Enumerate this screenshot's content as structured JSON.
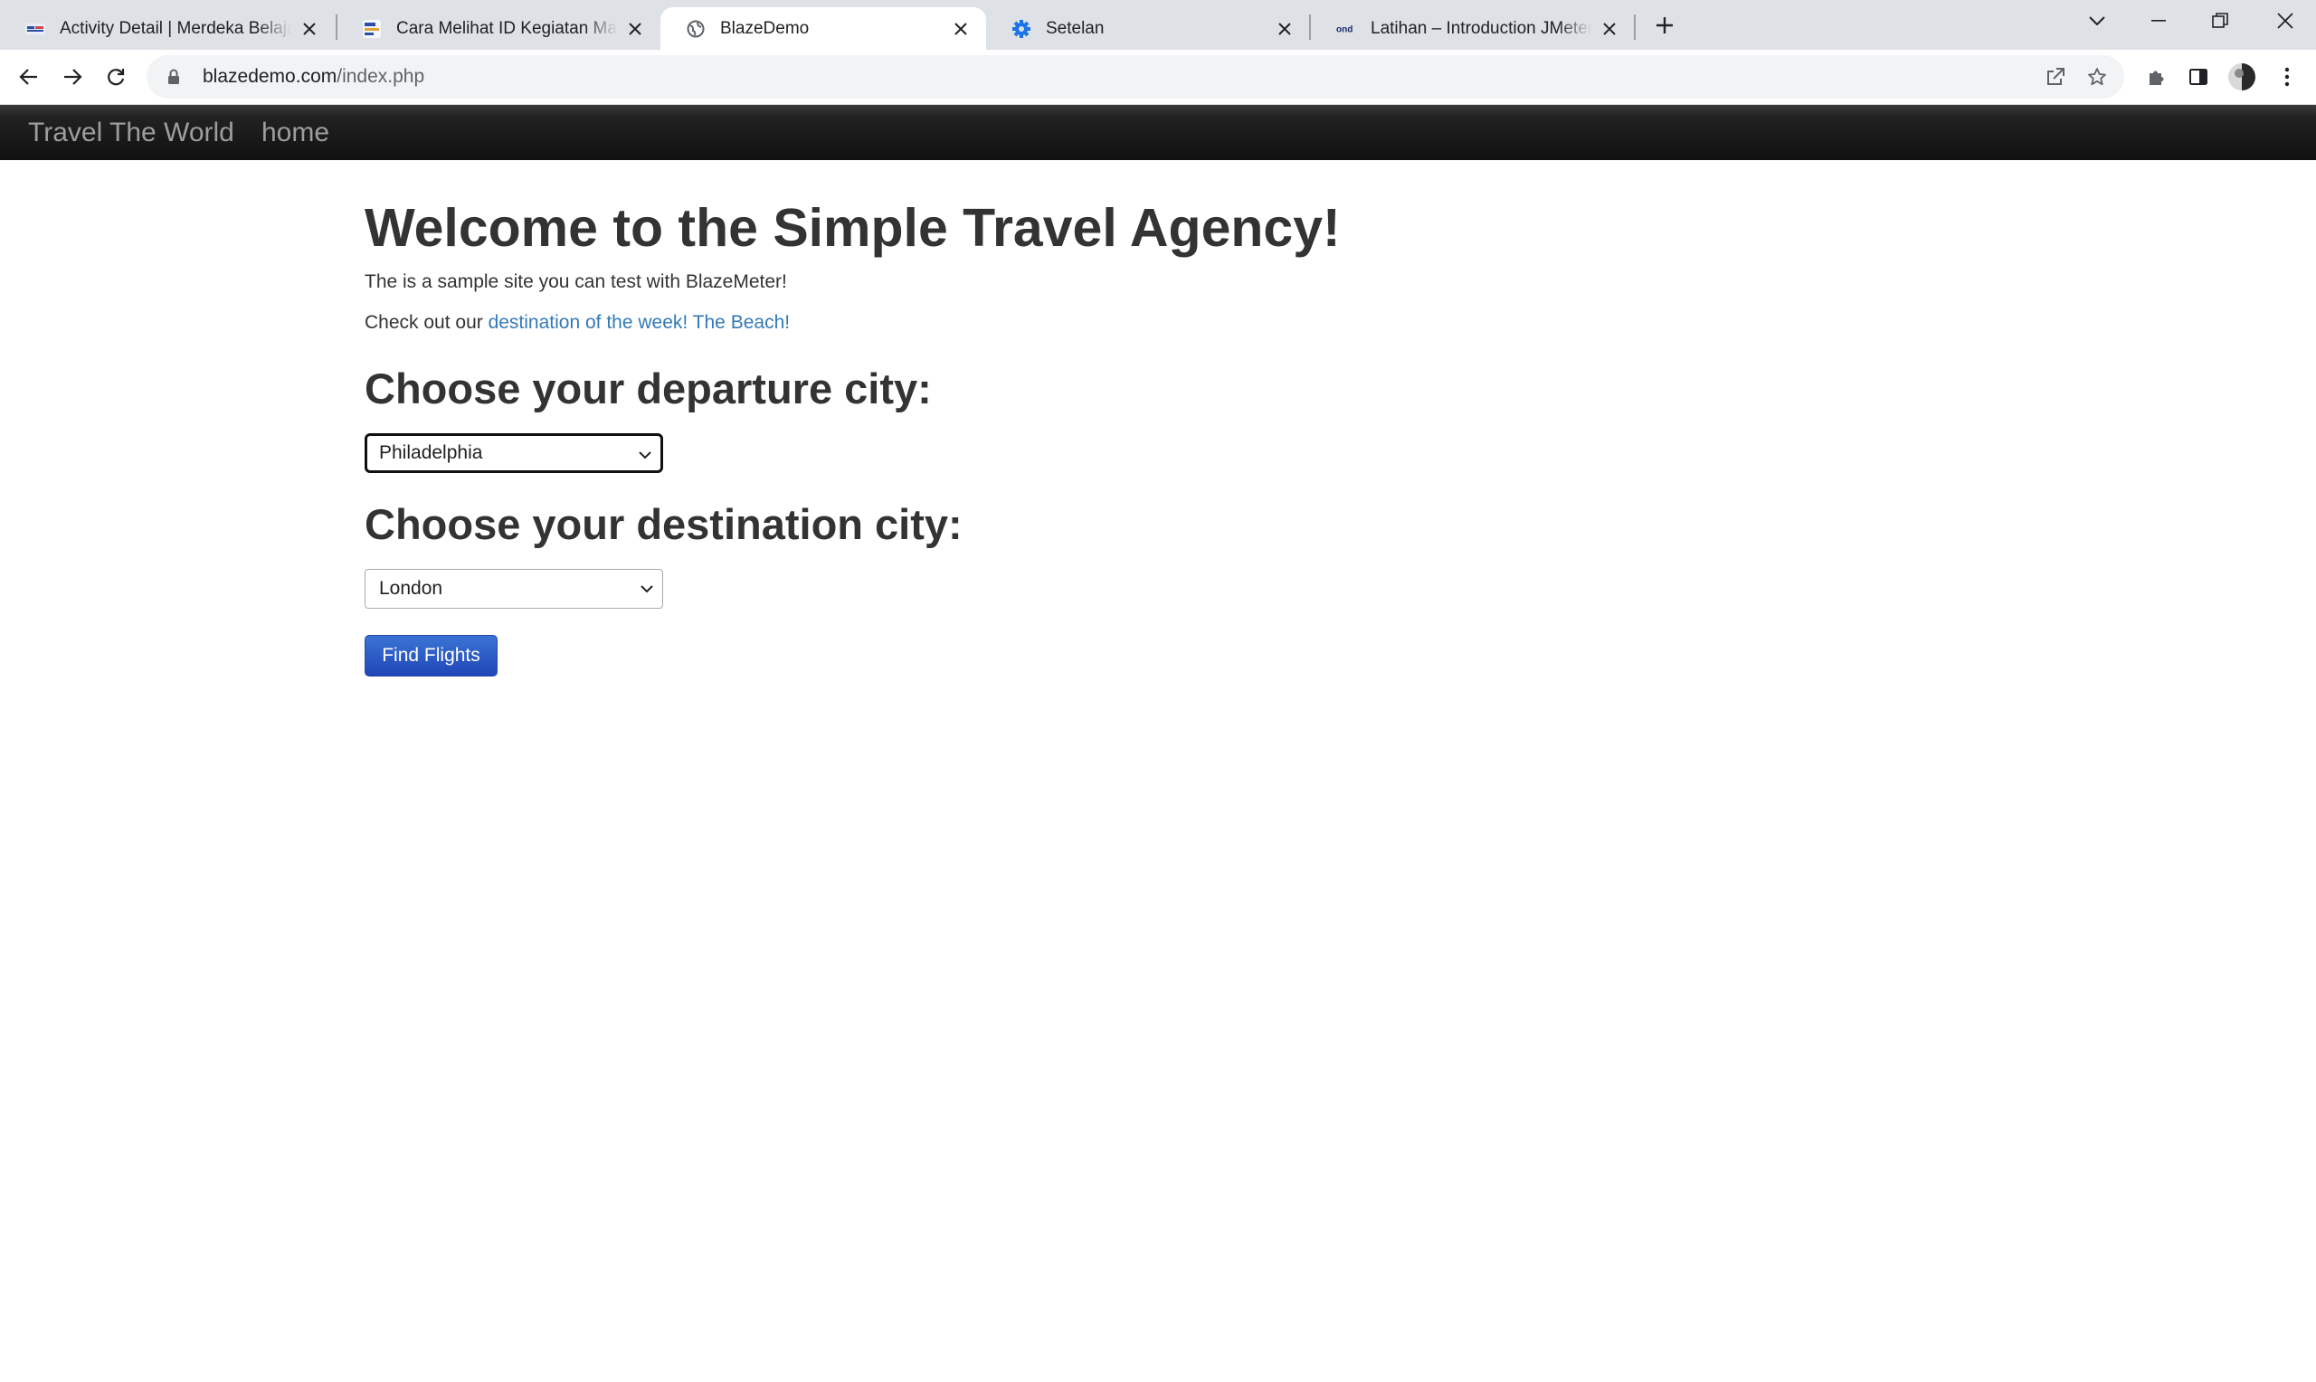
{
  "browser": {
    "tabs": [
      {
        "title": "Activity Detail | Merdeka Belajar",
        "favicon": "kampus-merdeka-icon"
      },
      {
        "title": "Cara Melihat ID Kegiatan Mahasiswa",
        "favicon": "kampus-merdeka-icon"
      },
      {
        "title": "BlazeDemo",
        "favicon": "globe-icon"
      },
      {
        "title": "Setelan",
        "favicon": "gear-icon"
      },
      {
        "title": "Latihan – Introduction JMeter and",
        "favicon": "ond-icon"
      }
    ],
    "active_tab_index": 2,
    "url_host": "blazedemo.com",
    "url_path": "/index.php",
    "colors": {
      "tab_strip": "#dee1e6",
      "omnibox": "#f1f3f4",
      "settings_icon": "#1a73e8"
    }
  },
  "navbar": {
    "brand": "Travel The World",
    "links": [
      "home"
    ]
  },
  "main": {
    "heading": "Welcome to the Simple Travel Agency!",
    "intro": "The is a sample site you can test with BlazeMeter!",
    "checkout_prefix": "Check out our ",
    "checkout_link": "destination of the week! The Beach!",
    "departure_heading": "Choose your departure city:",
    "departure_value": "Philadelphia",
    "destination_heading": "Choose your destination city:",
    "destination_value": "London",
    "find_button": "Find Flights",
    "colors": {
      "link": "#337ab7",
      "button": "#2a57c4",
      "navbar": "#1a1a1a",
      "text": "#333333"
    }
  }
}
